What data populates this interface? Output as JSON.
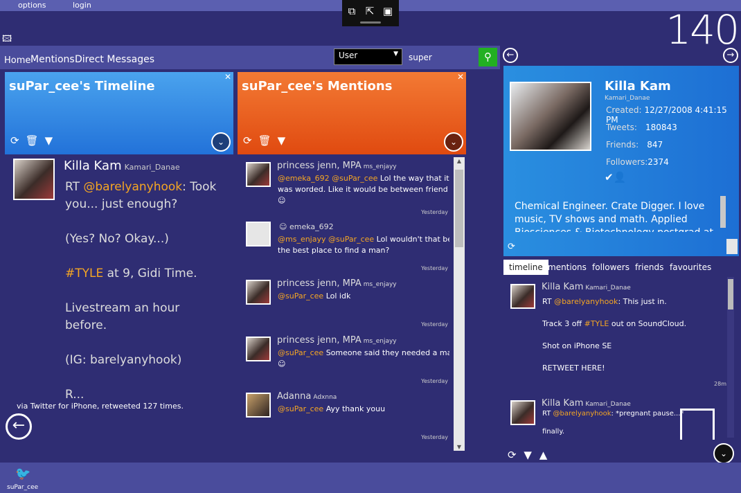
{
  "menu": {
    "options": "options",
    "login": "login"
  },
  "counter": "140",
  "nav": {
    "home": "Home",
    "mentions": "Mentions",
    "direct_messages": "Direct Messages"
  },
  "search": {
    "type_value": "User",
    "query": "super"
  },
  "timeline_column": {
    "title": "suPar_cee's Timeline",
    "tweet": {
      "name": "Killa Kam",
      "handle": "Kamari_Danae",
      "prefix": "RT ",
      "mention": "@barelyanyhook",
      "text_a": ": Took you... just enough?\n\n(Yes? No? Okay...)\n\n",
      "hashtag": "#TYLE",
      "text_b": " at 9, Gidi Time.\n\nLivestream an hour before.\n\n(IG: barelyanyhook)\n\nR...",
      "via": "via Twitter for iPhone, retweeted 127 times."
    }
  },
  "mentions_column": {
    "title": "suPar_cee's Mentions",
    "items": [
      {
        "name": "princess jenn, MPA",
        "handle": "ms_enjayy",
        "mention": "@emeka_692 @suPar_cee",
        "text": " Lol the way that it",
        "line2": "was worded. Like it would be between friend",
        "time": "Yesterday"
      },
      {
        "name": "emeka_692",
        "handle": "",
        "mention": "@ms_enjayy @suPar_cee",
        "text": " Lol wouldn't that be",
        "line2": "the best place to find a man?",
        "time": "Yesterday"
      },
      {
        "name": "princess jenn, MPA",
        "handle": "ms_enjayy",
        "mention": "@suPar_cee",
        "text": " Lol idk",
        "line2": "",
        "time": "Yesterday"
      },
      {
        "name": "princess jenn, MPA",
        "handle": "ms_enjayy",
        "mention": "@suPar_cee",
        "text": " Someone said they needed a man",
        "line2": "",
        "time": "Yesterday"
      },
      {
        "name": "Adanna",
        "handle": "Adxnna",
        "mention": "@suPar_cee",
        "text": " Ayy thank youu",
        "line2": "",
        "time": "Yesterday"
      }
    ]
  },
  "profile": {
    "name": "Killa Kam",
    "handle": "Kamari_Danae",
    "created_label": "Created:",
    "created": "12/27/2008 4:41:15 PM",
    "tweets_label": "Tweets:",
    "tweets": "180843",
    "friends_label": "Friends:",
    "friends": "847",
    "followers_label": "Followers:",
    "followers": "2374",
    "bio": "Chemical Engineer. Crate Digger. I love music, TV shows and math. Applied Biosciences & Biotechnology postgrad at Imperial College"
  },
  "profile_tabs": [
    "timeline",
    "mentions",
    "followers",
    "friends",
    "favourites"
  ],
  "profile_timeline": [
    {
      "name": "Killa Kam",
      "handle": "Kamari_Danae",
      "prefix": "RT ",
      "mention": "@barelyanyhook",
      "line1": ": This just in.",
      "line2a": "Track 3 off ",
      "hashtag": "#TYLE",
      "line2b": " out on SoundCloud.",
      "line3": "Shot on iPhone SE",
      "line4": "RETWEET HERE!",
      "time": "28m"
    },
    {
      "name": "Killa Kam",
      "handle": "Kamari_Danae",
      "prefix": "RT ",
      "mention": "@barelyanyhook",
      "line1": ": *pregnant pause...*",
      "line2": "finally."
    }
  ],
  "current_user": "suPar_cee"
}
